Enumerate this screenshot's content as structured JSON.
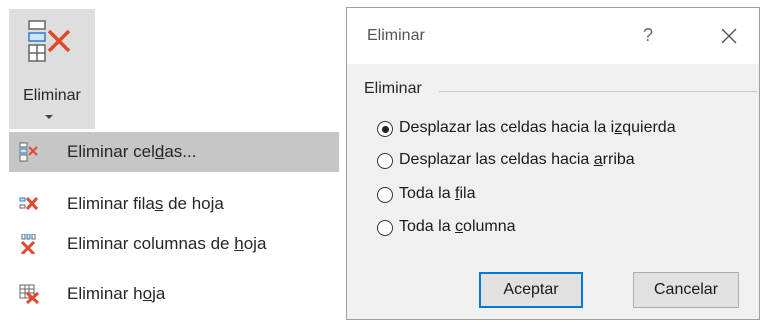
{
  "ribbon": {
    "label": "Eliminar",
    "icon": "delete-cells-icon"
  },
  "menu": {
    "items": [
      {
        "pre": "Eliminar cel",
        "u": "d",
        "post": "as...",
        "icon": "delete-cells-icon",
        "highlighted": true
      },
      {
        "pre": "Eliminar fila",
        "u": "s",
        "post": " de hoja",
        "icon": "delete-rows-icon"
      },
      {
        "pre": "Eliminar columnas de ",
        "u": "h",
        "post": "oja",
        "icon": "delete-columns-icon"
      },
      {
        "pre": "Eliminar h",
        "u": "o",
        "post": "ja",
        "icon": "delete-sheet-icon"
      }
    ]
  },
  "dialog": {
    "title": "Eliminar",
    "help": "?",
    "group_label": "Eliminar",
    "options": [
      {
        "pre": "Desplazar las celdas hacia la i",
        "u": "z",
        "post": "quierda",
        "checked": true
      },
      {
        "pre": "Desplazar las celdas hacia ",
        "u": "a",
        "post": "rriba",
        "checked": false
      },
      {
        "pre": "Toda la ",
        "u": "f",
        "post": "ila",
        "checked": false
      },
      {
        "pre": "Toda la ",
        "u": "c",
        "post": "olumna",
        "checked": false
      }
    ],
    "ok_label": "Aceptar",
    "cancel_label": "Cancelar"
  },
  "colors": {
    "delete_x": "#e0492b",
    "ribbon_bg": "#dedede",
    "hover_bg": "#c6c6c6",
    "dialog_bg": "#f0f0f0",
    "focus_border": "#0078d7"
  }
}
